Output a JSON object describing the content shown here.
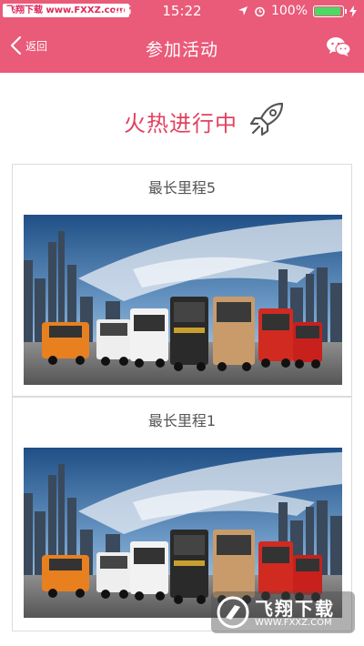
{
  "status_bar": {
    "watermark_text": "飞翔下载 www.FXXZ.com",
    "carrier": "4G",
    "time": "15:22",
    "battery": "100%"
  },
  "nav": {
    "back_label": "返回",
    "title": "参加活动"
  },
  "hero": {
    "text": "火热进行中"
  },
  "activities": [
    {
      "title": "最长里程5"
    },
    {
      "title": "最长里程1"
    }
  ],
  "watermark": {
    "title": "飞翔下载",
    "url": "WWW.FXXZ.COM"
  },
  "colors": {
    "brand": "#ea5a79",
    "hero_text": "#e2415f"
  }
}
